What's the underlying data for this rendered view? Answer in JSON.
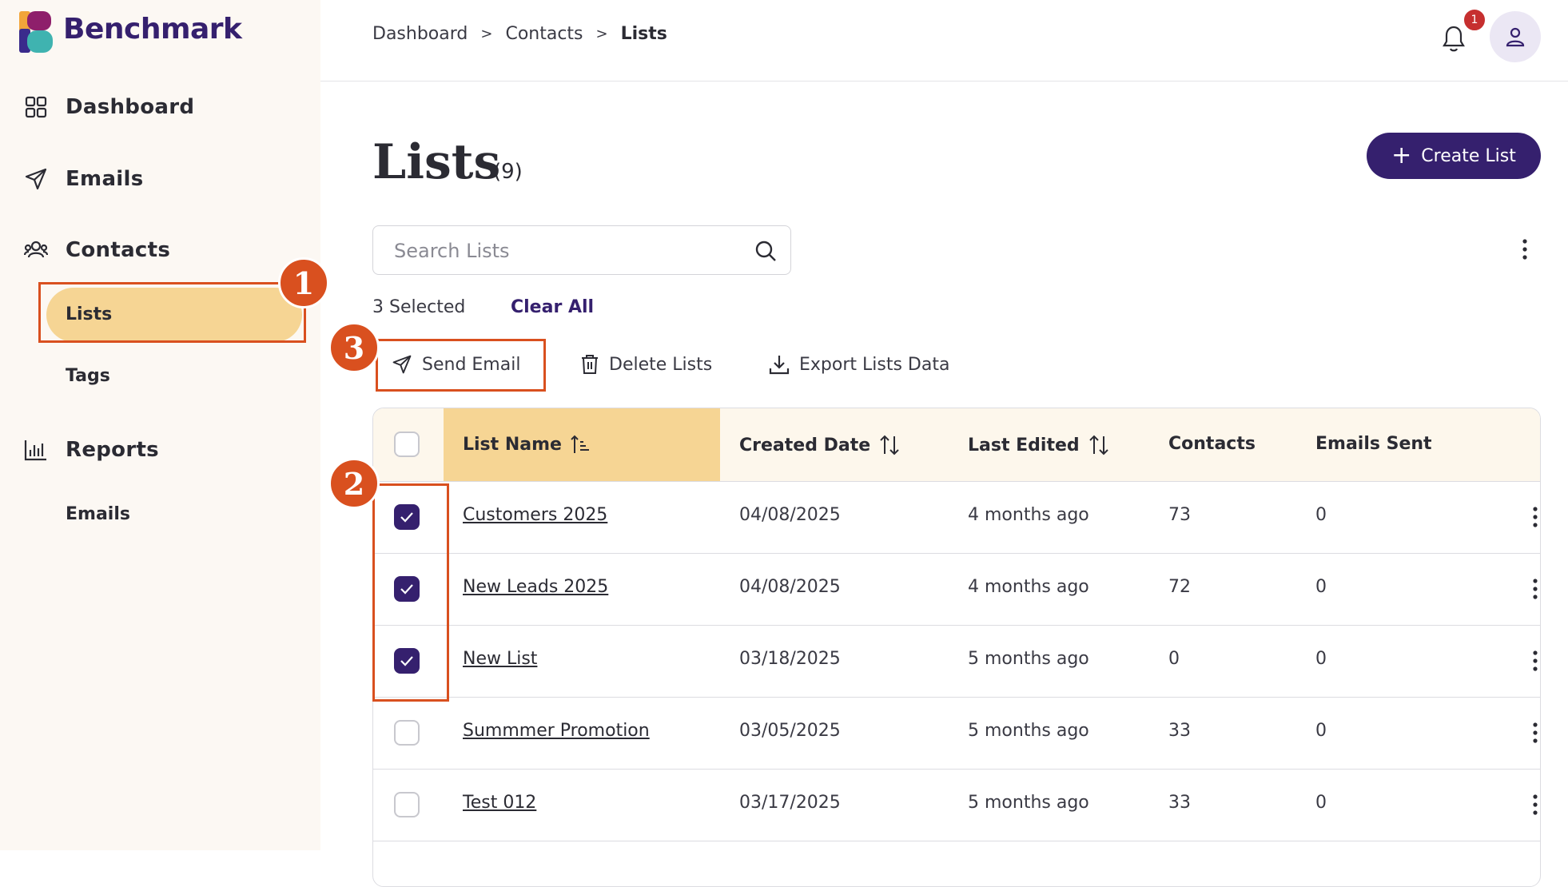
{
  "app": {
    "name": "Benchmark"
  },
  "sidebar": {
    "items": [
      {
        "label": "Dashboard",
        "icon": "grid-icon"
      },
      {
        "label": "Emails",
        "icon": "send-icon"
      },
      {
        "label": "Contacts",
        "icon": "users-icon"
      },
      {
        "label": "Reports",
        "icon": "bar-chart-icon"
      }
    ],
    "contacts_sub": [
      "Lists",
      "Tags"
    ],
    "reports_sub": [
      "Emails"
    ]
  },
  "breadcrumb": [
    "Dashboard",
    "Contacts",
    "Lists"
  ],
  "header": {
    "notification_count": "1"
  },
  "page": {
    "title": "Lists",
    "count": "(9)",
    "create_label": "Create List"
  },
  "search": {
    "placeholder": "Search Lists"
  },
  "selection": {
    "count_text": "3 Selected",
    "clear_label": "Clear All"
  },
  "actions": {
    "send_email": "Send Email",
    "delete_lists": "Delete Lists",
    "export": "Export Lists Data"
  },
  "annotations": [
    "1",
    "2",
    "3"
  ],
  "table": {
    "columns": [
      "List Name",
      "Created Date",
      "Last Edited",
      "Contacts",
      "Emails Sent"
    ],
    "rows": [
      {
        "name": "Customers 2025",
        "created": "04/08/2025",
        "edited": "4 months ago",
        "contacts": "73",
        "sent": "0",
        "checked": true
      },
      {
        "name": "New Leads 2025",
        "created": "04/08/2025",
        "edited": "4 months ago",
        "contacts": "72",
        "sent": "0",
        "checked": true
      },
      {
        "name": "New List",
        "created": "03/18/2025",
        "edited": "5 months ago",
        "contacts": "0",
        "sent": "0",
        "checked": true
      },
      {
        "name": "Summmer Promotion",
        "created": "03/05/2025",
        "edited": "5 months ago",
        "contacts": "33",
        "sent": "0",
        "checked": false
      },
      {
        "name": "Test 012",
        "created": "03/17/2025",
        "edited": "5 months ago",
        "contacts": "33",
        "sent": "0",
        "checked": false
      }
    ]
  },
  "colors": {
    "brand": "#35206e",
    "highlight": "#f6d594",
    "annotation": "#d9501f",
    "sidebar_bg": "#fcf8f3"
  }
}
